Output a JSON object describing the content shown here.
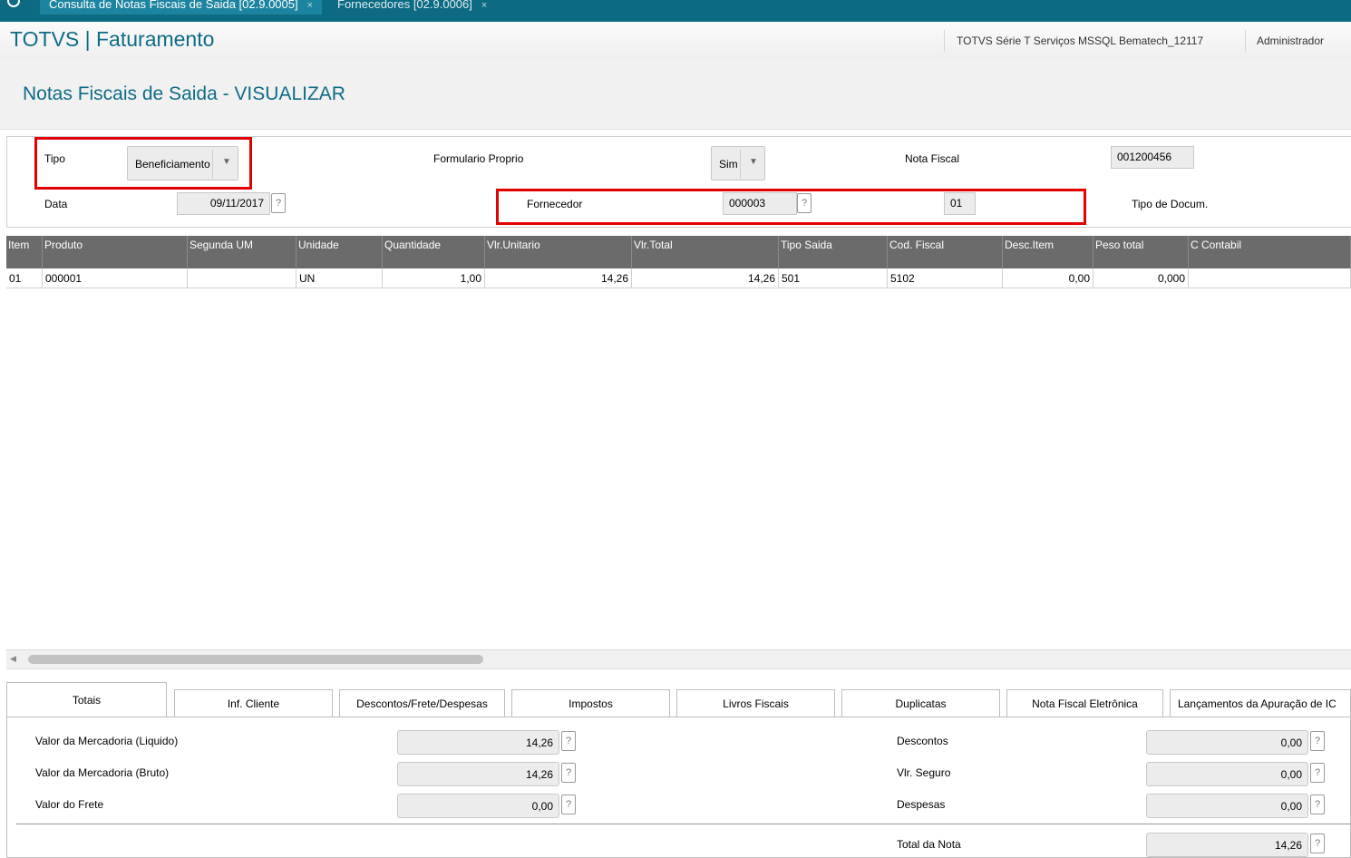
{
  "tabs": [
    {
      "label": "Consulta de Notas Fiscais de Saida [02.9.0005]",
      "close": "×"
    },
    {
      "label": "Fornecedores [02.9.0006]",
      "close": "×"
    }
  ],
  "header": {
    "app_title": "TOTVS | Faturamento",
    "environment": "TOTVS Série T Serviços MSSQL Bematech_12117",
    "user": "Administrador"
  },
  "page_title": "Notas Fiscais de Saida - VISUALIZAR",
  "form": {
    "tipo_label": "Tipo",
    "tipo_value": "Beneficiamento",
    "formulario_label": "Formulario Proprio",
    "formulario_value": "Sim",
    "nota_label": "Nota Fiscal",
    "nota_value": "001200456",
    "data_label": "Data",
    "data_value": "09/11/2017",
    "fornecedor_label": "Fornecedor",
    "fornecedor_value": "000003",
    "loja_value": "01",
    "tipo_doc_label": "Tipo de Docum.",
    "help": "?"
  },
  "grid": {
    "columns": [
      "Item",
      "Produto",
      "Segunda UM",
      "Unidade",
      "Quantidade",
      "Vlr.Unitario",
      "Vlr.Total",
      "Tipo Saida",
      "Cod. Fiscal",
      "Desc.Item",
      "Peso total",
      "C Contabil"
    ],
    "rows": [
      [
        "01",
        "000001",
        "",
        "UN",
        "1,00",
        "14,26",
        "14,26",
        "501",
        "5102",
        "0,00",
        "0,000",
        ""
      ]
    ]
  },
  "folders": [
    "Totais",
    "Inf. Cliente",
    "Descontos/Frete/Despesas",
    "Impostos",
    "Livros Fiscais",
    "Duplicatas",
    "Nota Fiscal Eletrônica",
    "Lançamentos da Apuração de IC"
  ],
  "totais": {
    "merc_liq_label": "Valor da Mercadoria (Liquido)",
    "merc_liq_value": "14,26",
    "merc_bruto_label": "Valor da Mercadoria (Bruto)",
    "merc_bruto_value": "14,26",
    "frete_label": "Valor do Frete",
    "frete_value": "0,00",
    "descontos_label": "Descontos",
    "descontos_value": "0,00",
    "seguro_label": "Vlr. Seguro",
    "seguro_value": "0,00",
    "despesas_label": "Despesas",
    "despesas_value": "0,00",
    "total_label": "Total da Nota",
    "total_value": "14,26"
  },
  "colors": {
    "accent": "#0f6b87",
    "tabbar": "#0c6b82",
    "grid_header": "#6b6b6b",
    "highlight": "#e30000"
  }
}
